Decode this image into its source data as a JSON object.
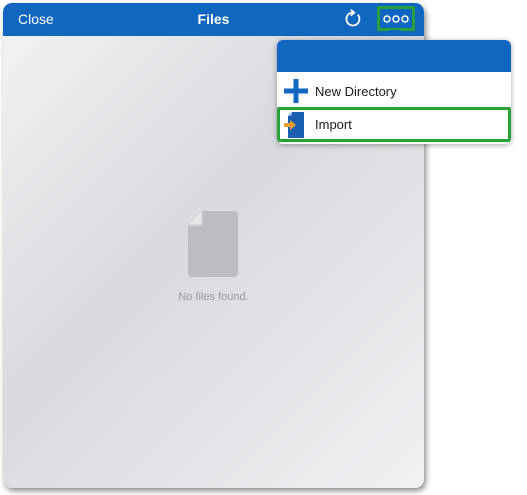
{
  "navbar": {
    "close_label": "Close",
    "title": "Files",
    "refresh_icon": "refresh-icon",
    "more_icon": "more-icon"
  },
  "empty_state": {
    "icon": "file-icon",
    "message": "No files found."
  },
  "menu": {
    "items": [
      {
        "label": "New Directory",
        "icon": "plus-icon"
      },
      {
        "label": "Import",
        "icon": "import-icon"
      }
    ]
  },
  "colors": {
    "accent": "#1166c0",
    "highlight": "#27a23a",
    "import_arrow": "#f0a030"
  }
}
